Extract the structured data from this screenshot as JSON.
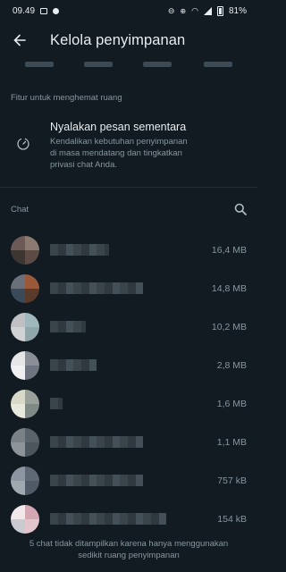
{
  "status_bar": {
    "time": "09.49",
    "battery": "81%"
  },
  "app_bar": {
    "title": "Kelola penyimpanan"
  },
  "features_section": {
    "label": "Fitur untuk menghemat ruang",
    "item": {
      "title": "Nyalakan pesan sementara",
      "description_lines": [
        "Kendalikan kebutuhan penyimpanan",
        "di masa mendatang dan tingkatkan",
        "privasi chat Anda."
      ]
    }
  },
  "chats_section": {
    "label": "Chat",
    "rows": [
      {
        "size": "16,4 MB",
        "avatar_colors": [
          "#6b5a55",
          "#8a7a70",
          "#3c3633",
          "#5c4a44"
        ]
      },
      {
        "size": "14,8 MB",
        "avatar_colors": [
          "#6a6f7a",
          "#9a5a3a",
          "#3a4a5a",
          "#5a3a2a"
        ]
      },
      {
        "size": "10,2 MB",
        "avatar_colors": [
          "#c0bfc3",
          "#9fb8bd",
          "#d0d2d4",
          "#8fa6aa"
        ]
      },
      {
        "size": "2,8 MB",
        "avatar_colors": [
          "#e6e6e8",
          "#8a8e96",
          "#f0f0f2",
          "#6f7580"
        ]
      },
      {
        "size": "1,6 MB",
        "avatar_colors": [
          "#d9d9c8",
          "#9aa19a",
          "#e8e8dc",
          "#7f8a86"
        ]
      },
      {
        "size": "1,1 MB",
        "avatar_colors": [
          "#7a8288",
          "#5a636a",
          "#8d959b",
          "#4d565d"
        ]
      },
      {
        "size": "757 kB",
        "avatar_colors": [
          "#8c95a0",
          "#5e6975",
          "#a0a8b0",
          "#4f5a66"
        ]
      },
      {
        "size": "154 kB",
        "avatar_colors": [
          "#f0e8ea",
          "#d4a8b2",
          "#c9cbd0",
          "#e2c6cc"
        ]
      }
    ]
  },
  "footer_lines": [
    "5 chat tidak ditampilkan karena hanya menggunakan",
    "sedikit ruang penyimpanan"
  ]
}
